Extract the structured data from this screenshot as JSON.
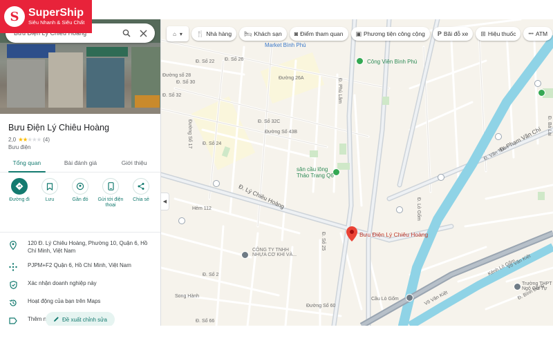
{
  "logo": {
    "brand": "SuperShip",
    "slogan": "Siêu Nhanh & Siêu Chất",
    "letter": "S"
  },
  "search": {
    "value": "Bưu Điện Lý Chiêu Hoàng"
  },
  "place": {
    "title": "Bưu Điện Lý Chiêu Hoàng",
    "rating": "2,0",
    "stars": 2,
    "reviews": "(4)",
    "category": "Bưu điện"
  },
  "tabs": [
    {
      "label": "Tổng quan"
    },
    {
      "label": "Bài đánh giá"
    },
    {
      "label": "Giới thiệu"
    }
  ],
  "actions": [
    {
      "label": "Đường đi",
      "icon": "directions-icon"
    },
    {
      "label": "Lưu",
      "icon": "bookmark-icon"
    },
    {
      "label": "Gần đó",
      "icon": "nearby-icon"
    },
    {
      "label": "Gửi tới điện thoại",
      "icon": "phone-icon"
    },
    {
      "label": "Chia sẻ",
      "icon": "share-icon"
    }
  ],
  "info": [
    {
      "text": "120 Đ. Lý Chiêu Hoàng, Phường 10, Quận 6, Hồ Chí Minh, Việt Nam",
      "icon": "location-icon"
    },
    {
      "text": "PJPM+F2 Quận 6, Hồ Chí Minh, Việt Nam",
      "icon": "plus-code-icon"
    },
    {
      "text": "Xác nhận doanh nghiệp này",
      "icon": "verified-icon"
    },
    {
      "text": "Hoạt động của bạn trên Maps",
      "icon": "history-icon"
    },
    {
      "text": "Thêm nhãn",
      "icon": "label-icon"
    }
  ],
  "suggest_edit": "Đề xuất chỉnh sửa",
  "chips": [
    {
      "label": "Nhà hàng",
      "icon": "restaurant-icon"
    },
    {
      "label": "Khách sạn",
      "icon": "hotel-icon"
    },
    {
      "label": "Điểm tham quan",
      "icon": "camera-icon"
    },
    {
      "label": "Phương tiện công cộng",
      "icon": "bus-icon"
    },
    {
      "label": "Bãi đỗ xe",
      "icon": "parking-icon"
    },
    {
      "label": "Hiệu thuốc",
      "icon": "pharmacy-icon"
    },
    {
      "label": "ATM",
      "icon": "atm-icon"
    }
  ],
  "map": {
    "labels": {
      "market": "Market Bình Phú",
      "park": "Công Viên Bình Phú",
      "court": "sân cầu lông\nThảo Trang Q6",
      "poi": "Bưu Điện Lý Chiêu Hoàng",
      "company": "CÔNG TY TNHH\nNHỰA CƠ KHÍ VÀ...",
      "bridge": "Cầu Lò Gốm",
      "school": "Trường THPT\nNgô Gia Tự",
      "main_road": "Đ. Lý Chiêu Hoàng",
      "pvc": "Đ. Phạm Văn Chí",
      "vvk": "Võ Văn Kiệt",
      "vvk2": "Võ Văn Kiệt",
      "klg": "Kênh Lò Gốm",
      "plam": "Đ. Phú Lâm",
      "lg": "Đ. Lò Gốm",
      "bd": "Đ. Bình Đông",
      "vt": "Đ. Văn Thân",
      "so26": "Đ. Số 26",
      "so28": "Đường số 28",
      "so30": "Đ. Số 30",
      "so32": "Đ. Số 32",
      "so24": "Đ. Số 24",
      "so22": "Đ. Số 22",
      "so17": "Đường Số 17",
      "so32c": "Đ. Số 32C",
      "so43b": "Đường Số 43B",
      "so25": "Đ. Số 25",
      "so60": "Đường Số 60",
      "so66": "Đ. Số 66",
      "d26a": "Đường 26A",
      "hem": "Hẻm 112",
      "song": "Song Hành",
      "bl": "Đ. Bà Lài",
      "so2": "Đ. Số 2"
    }
  },
  "colors": {
    "accent": "#137a6f",
    "logo_red": "#e8233a",
    "river": "#8fd3e6",
    "pin_red": "#ea4335",
    "pin_green": "#34a853"
  }
}
